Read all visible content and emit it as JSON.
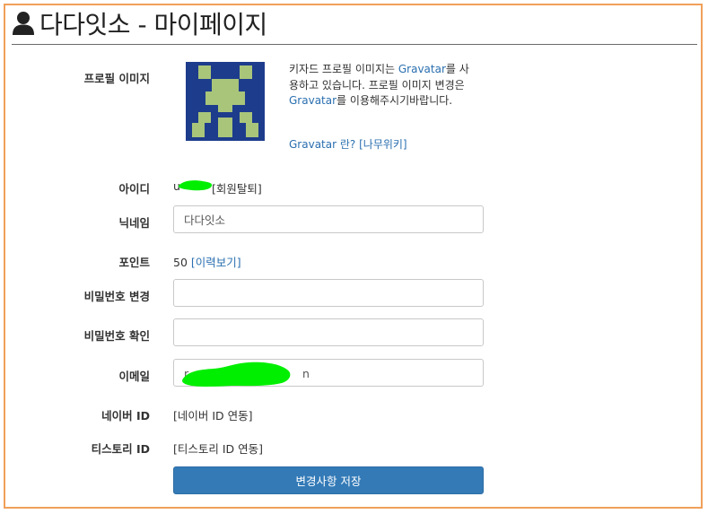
{
  "page": {
    "title": "다다잇소 - 마이페이지"
  },
  "colors": {
    "frame_border": "#f0a05a",
    "link": "#2a6fb0",
    "button": "#337ab7",
    "avatar_bg": "#1d3c8c",
    "avatar_fg": "#a9c57a",
    "redaction": "#00ee00"
  },
  "profile_image": {
    "label": "프로필 이미지",
    "desc_part1": "키자드 프로필 이미지는 ",
    "desc_link1": "Gravatar",
    "desc_part2": "를 사용하고 있습니다. 프로필 이미지 변경은 ",
    "desc_link2": "Gravatar",
    "desc_part3": "를 이용해주시기바랍니다.",
    "link_gravatar": "Gravatar 란?",
    "link_namuwiki": "[나무위키]"
  },
  "user_id": {
    "label": "아이디",
    "value_visible_prefix": "u",
    "withdraw_link": "[회원탈퇴]"
  },
  "nickname": {
    "label": "닉네임",
    "value": "다다잇소"
  },
  "points": {
    "label": "포인트",
    "value": "50",
    "history_link": "[이력보기]"
  },
  "password_change": {
    "label": "비밀번호 변경",
    "value": ""
  },
  "password_confirm": {
    "label": "비밀번호 확인",
    "value": ""
  },
  "email": {
    "label": "이메일",
    "value_visible_prefix": "r",
    "value_visible_suffix": "n"
  },
  "naver": {
    "label": "네이버 ID",
    "link": "[네이버 ID 연동]"
  },
  "tistory": {
    "label": "티스토리 ID",
    "link": "[티스토리 ID 연동]"
  },
  "submit": {
    "label": "변경사항 저장"
  }
}
